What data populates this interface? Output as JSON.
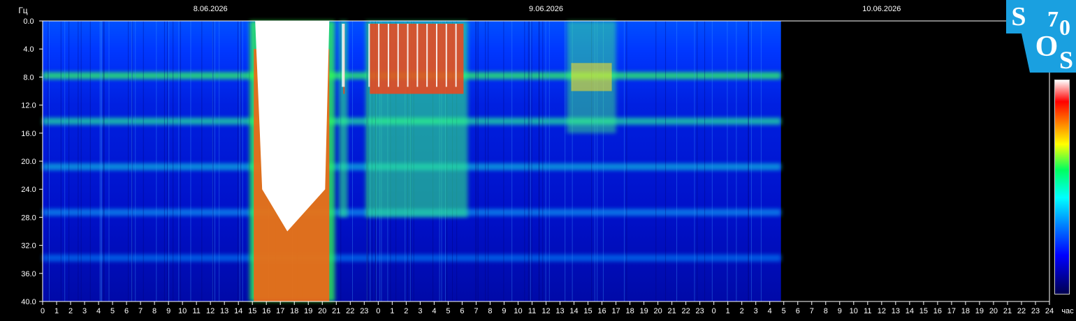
{
  "chart_data": {
    "type": "heatmap",
    "title": "",
    "ylabel": "Гц",
    "xlabel": "час",
    "ylim": [
      0,
      40
    ],
    "y_ticks": [
      "0.0",
      "4.0",
      "8.0",
      "12.0",
      "16.0",
      "20.0",
      "24.0",
      "28.0",
      "32.0",
      "36.0",
      "40.0"
    ],
    "x_ticks": [
      "0",
      "1",
      "2",
      "3",
      "4",
      "5",
      "6",
      "7",
      "8",
      "9",
      "10",
      "11",
      "12",
      "13",
      "14",
      "15",
      "16",
      "17",
      "18",
      "19",
      "20",
      "21",
      "22",
      "23",
      "0",
      "1",
      "2",
      "3",
      "4",
      "5",
      "6",
      "7",
      "8",
      "9",
      "10",
      "11",
      "12",
      "13",
      "14",
      "15",
      "16",
      "17",
      "18",
      "19",
      "20",
      "21",
      "22",
      "23",
      "0",
      "1",
      "2",
      "3",
      "4",
      "5",
      "6",
      "7",
      "8",
      "9",
      "10",
      "11",
      "12",
      "13",
      "14",
      "15",
      "16",
      "17",
      "18",
      "19",
      "20",
      "21",
      "22",
      "23",
      "24"
    ],
    "dates": [
      "8.06.2026",
      "9.06.2026",
      "10.06.2026"
    ],
    "data_end_hour": 52.8,
    "resonance_bands_hz": [
      7.8,
      14.3,
      20.8,
      27.3,
      33.8
    ],
    "bursts": [
      {
        "start_hour": 15.0,
        "end_hour": 20.7,
        "intensity": "very high"
      },
      {
        "start_hour": 21.2,
        "end_hour": 21.8,
        "intensity": "high"
      },
      {
        "start_hour": 23.1,
        "end_hour": 30.4,
        "intensity": "high"
      },
      {
        "start_hour": 37.5,
        "end_hour": 41.0,
        "intensity": "moderate"
      }
    ],
    "colorscale": [
      "#000050",
      "#0000ff",
      "#0080ff",
      "#00ffff",
      "#00ff60",
      "#ffff00",
      "#ff8000",
      "#ff0000",
      "#ffffff"
    ]
  },
  "logo": {
    "letters": [
      "S",
      "O",
      "S"
    ],
    "number": "70",
    "bg_color": "#1aa0e0"
  }
}
